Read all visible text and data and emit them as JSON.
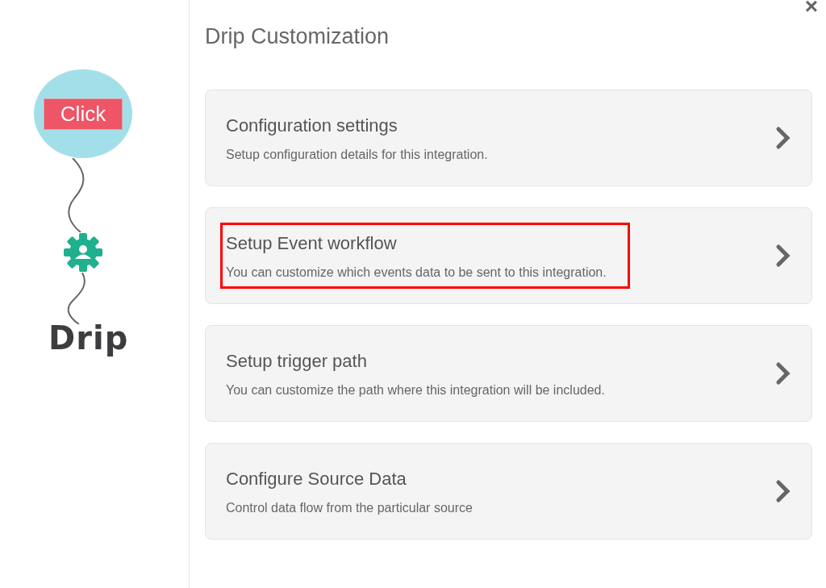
{
  "flow": {
    "trigger_label": "Click",
    "logo_text": "Drip"
  },
  "title": "Drip Customization",
  "close": "×",
  "options": [
    {
      "title": "Configuration settings",
      "description": "Setup configuration details for this integration.",
      "highlighted": false
    },
    {
      "title": "Setup Event workflow",
      "description": "You can customize which events data to be sent to this integration.",
      "highlighted": true
    },
    {
      "title": "Setup trigger path",
      "description": "You can customize the path where this integration will be included.",
      "highlighted": false
    },
    {
      "title": "Configure Source Data",
      "description": "Control data flow from the particular source",
      "highlighted": false
    }
  ]
}
